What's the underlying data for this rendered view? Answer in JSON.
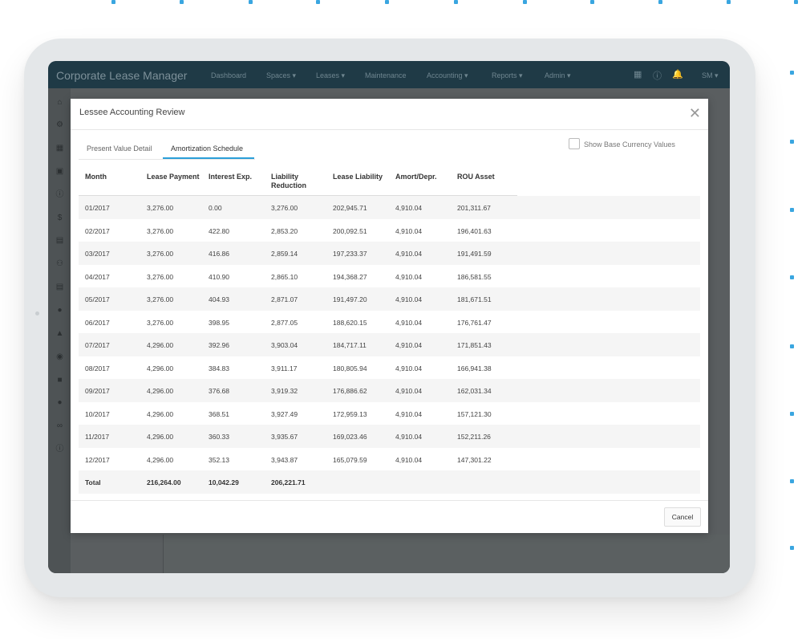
{
  "app": {
    "title": "Corporate Lease Manager"
  },
  "nav": {
    "items": [
      "Dashboard",
      "Spaces ▾",
      "Leases ▾",
      "Maintenance",
      "Accounting ▾",
      "Reports ▾",
      "Admin ▾"
    ],
    "user": "SM ▾"
  },
  "modal": {
    "title": "Lessee Accounting Review",
    "tabs": [
      "Present Value Detail",
      "Amortization Schedule"
    ],
    "active_tab": "Amortization Schedule",
    "checkbox_label": "Show Base Currency Values",
    "cancel_label": "Cancel"
  },
  "table": {
    "headers": [
      "Month",
      "Lease Payment",
      "Interest Exp.",
      "Liability\nReduction",
      "Lease Liability",
      "Amort/Depr.",
      "ROU Asset"
    ],
    "rows": [
      [
        "01/2017",
        "3,276.00",
        "0.00",
        "3,276.00",
        "202,945.71",
        "4,910.04",
        "201,311.67"
      ],
      [
        "02/2017",
        "3,276.00",
        "422.80",
        "2,853.20",
        "200,092.51",
        "4,910.04",
        "196,401.63"
      ],
      [
        "03/2017",
        "3,276.00",
        "416.86",
        "2,859.14",
        "197,233.37",
        "4,910.04",
        "191,491.59"
      ],
      [
        "04/2017",
        "3,276.00",
        "410.90",
        "2,865.10",
        "194,368.27",
        "4,910.04",
        "186,581.55"
      ],
      [
        "05/2017",
        "3,276.00",
        "404.93",
        "2,871.07",
        "191,497.20",
        "4,910.04",
        "181,671.51"
      ],
      [
        "06/2017",
        "3,276.00",
        "398.95",
        "2,877.05",
        "188,620.15",
        "4,910.04",
        "176,761.47"
      ],
      [
        "07/2017",
        "4,296.00",
        "392.96",
        "3,903.04",
        "184,717.11",
        "4,910.04",
        "171,851.43"
      ],
      [
        "08/2017",
        "4,296.00",
        "384.83",
        "3,911.17",
        "180,805.94",
        "4,910.04",
        "166,941.38"
      ],
      [
        "09/2017",
        "4,296.00",
        "376.68",
        "3,919.32",
        "176,886.62",
        "4,910.04",
        "162,031.34"
      ],
      [
        "10/2017",
        "4,296.00",
        "368.51",
        "3,927.49",
        "172,959.13",
        "4,910.04",
        "157,121.30"
      ],
      [
        "11/2017",
        "4,296.00",
        "360.33",
        "3,935.67",
        "169,023.46",
        "4,910.04",
        "152,211.26"
      ],
      [
        "12/2017",
        "4,296.00",
        "352.13",
        "3,943.87",
        "165,079.59",
        "4,910.04",
        "147,301.22"
      ]
    ],
    "total": [
      "Total",
      "216,264.00",
      "10,042.29",
      "206,221.71"
    ]
  },
  "icons": [
    "trash-icon",
    "help-icon",
    "notification-icon",
    "user-menu"
  ],
  "colors": {
    "accent": "#2b9fd9",
    "navbar": "#1f3a46"
  }
}
